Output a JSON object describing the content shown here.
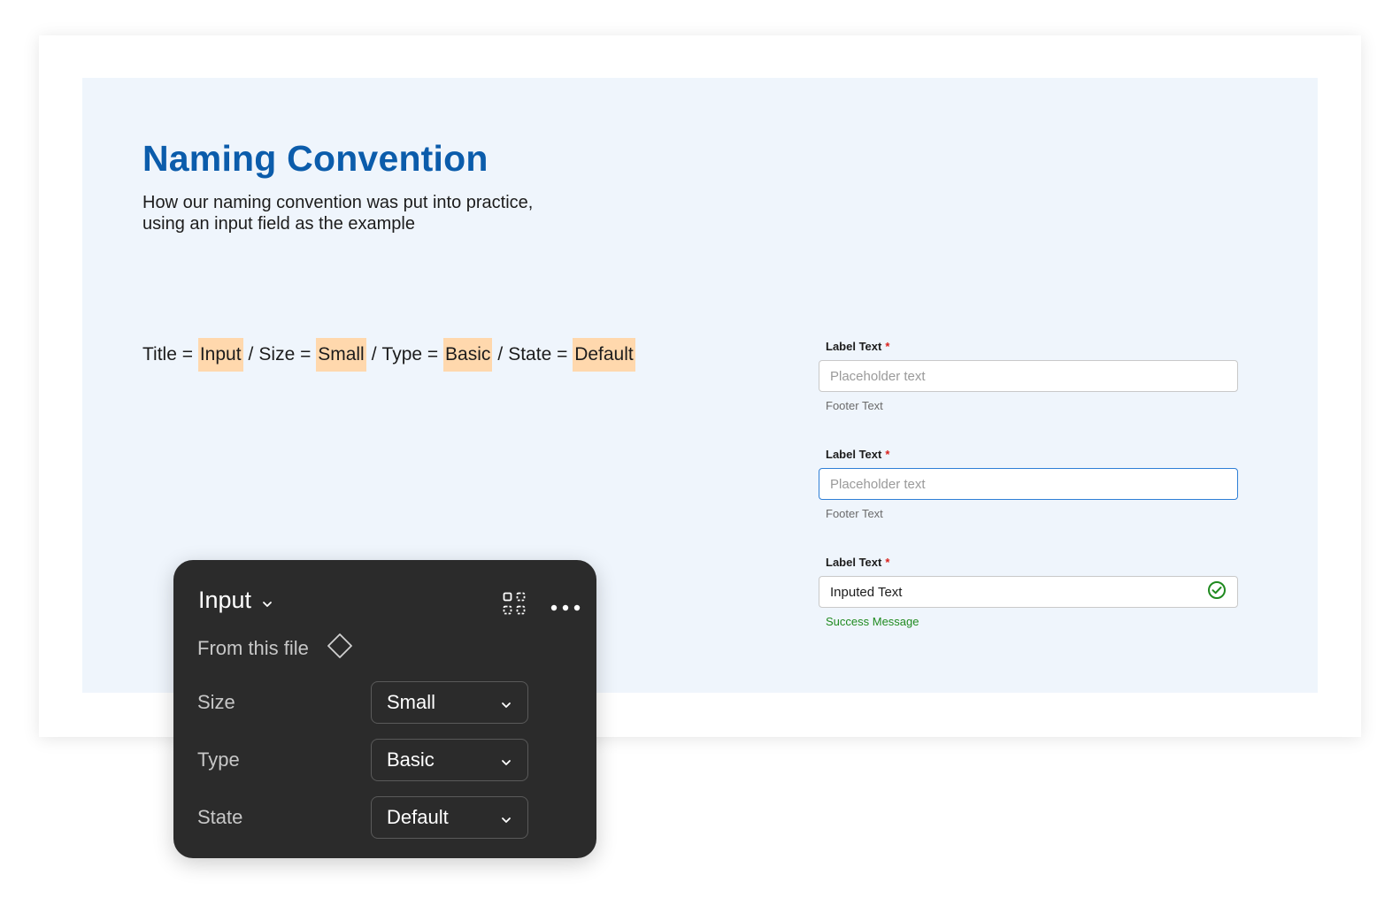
{
  "header": {
    "title": "Naming Convention",
    "subtitle": "How our naming convention was put into practice, using an input field as the example"
  },
  "formula": {
    "title_label": "Title = ",
    "title_value": "Input",
    "size_label": "Size = ",
    "size_value": "Small",
    "type_label": "Type = ",
    "type_value": "Basic",
    "state_label": "State = ",
    "state_value": "Default",
    "separator": "/",
    "highlight_color": "#ffd8ad"
  },
  "fields": [
    {
      "label": "Label Text",
      "required_mark": "*",
      "placeholder": "Placeholder text",
      "footer": "Footer Text",
      "state": "default"
    },
    {
      "label": "Label Text",
      "required_mark": "*",
      "placeholder": "Placeholder text",
      "footer": "Footer Text",
      "state": "focused"
    },
    {
      "label": "Label Text",
      "required_mark": "*",
      "value": "Inputed Text",
      "footer": "Success Message",
      "state": "success",
      "icon": "check-circle-icon"
    }
  ],
  "panel": {
    "title": "Input",
    "from_file": "From this file",
    "props": [
      {
        "label": "Size",
        "value": "Small"
      },
      {
        "label": "Type",
        "value": "Basic"
      },
      {
        "label": "State",
        "value": "Default"
      }
    ]
  },
  "colors": {
    "title": "#0b5cab",
    "canvas_bg": "#eff5fc",
    "panel_bg": "#2b2b2b",
    "focus_border": "#2f7fd6",
    "success": "#1f8a1f",
    "required": "#d9201b"
  }
}
